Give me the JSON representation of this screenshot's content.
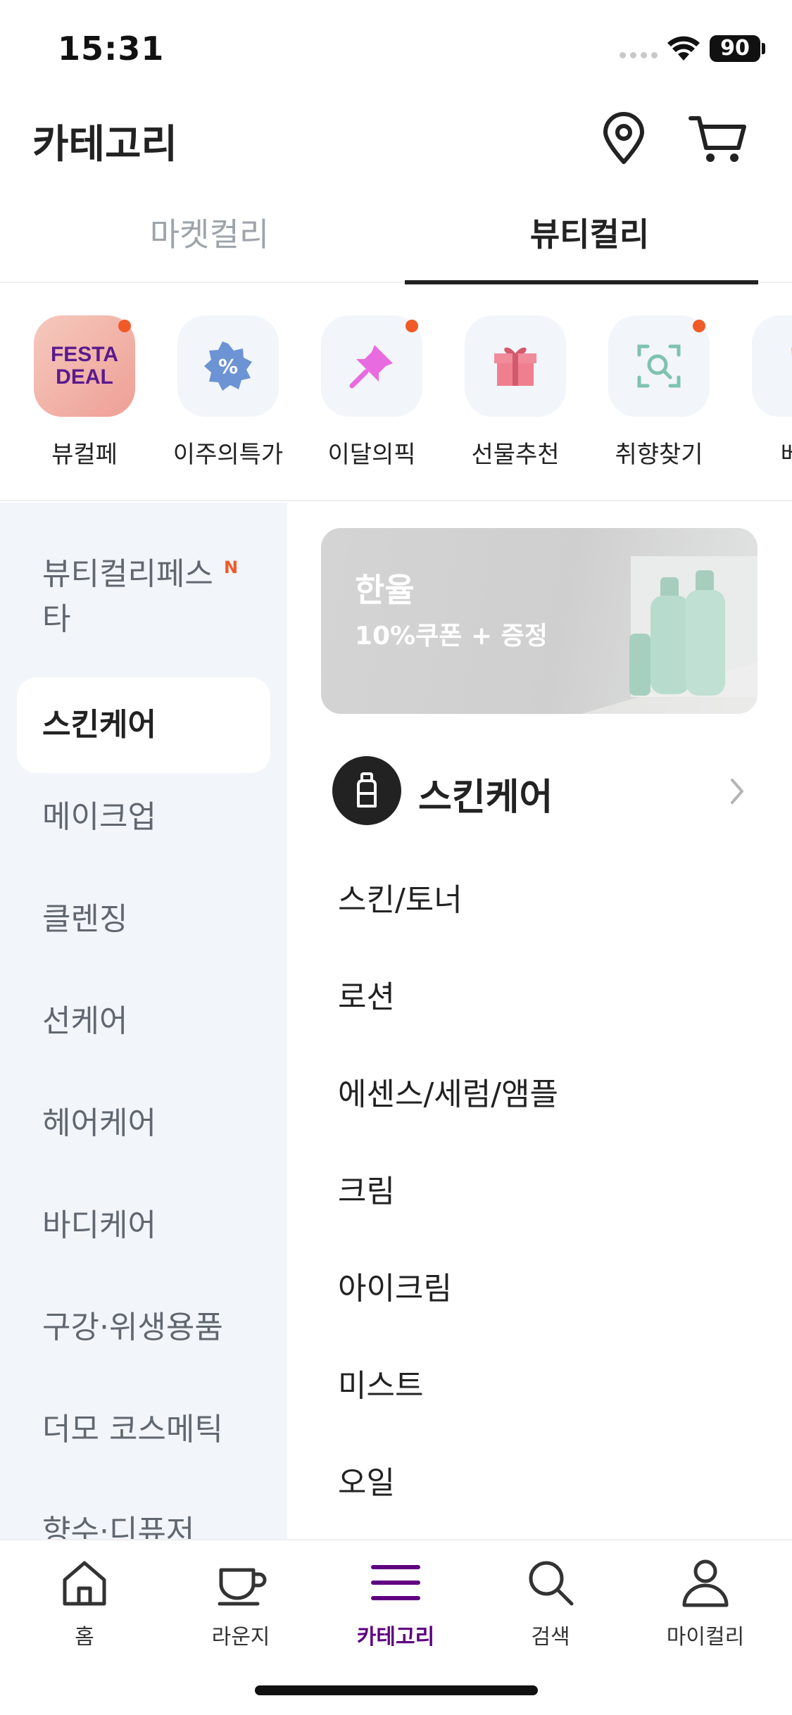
{
  "status_bar": {
    "time": "15:31",
    "battery": "90"
  },
  "header": {
    "title": "카테고리",
    "location_icon": "location-pin-icon",
    "cart_icon": "cart-icon"
  },
  "top_tabs": [
    {
      "label": "마켓컬리",
      "active": false
    },
    {
      "label": "뷰티컬리",
      "active": true
    }
  ],
  "quick_menu": [
    {
      "label": "뷰컬페",
      "icon": "festa-deal-icon",
      "icon_text_1": "FESTA",
      "icon_text_2": "DEAL",
      "dot": true
    },
    {
      "label": "이주의특가",
      "icon": "percent-badge-icon",
      "dot": false
    },
    {
      "label": "이달의픽",
      "icon": "pin-icon",
      "dot": true
    },
    {
      "label": "선물추천",
      "icon": "gift-icon",
      "dot": false
    },
    {
      "label": "취향찾기",
      "icon": "search-scan-icon",
      "dot": true
    },
    {
      "label": "베스",
      "icon": "trophy-icon",
      "dot": false
    }
  ],
  "categories": [
    {
      "label": "뷰티컬리페스타",
      "badge": "N",
      "selected": false
    },
    {
      "label": "스킨케어",
      "selected": true
    },
    {
      "label": "메이크업",
      "selected": false
    },
    {
      "label": "클렌징",
      "selected": false
    },
    {
      "label": "선케어",
      "selected": false
    },
    {
      "label": "헤어케어",
      "selected": false
    },
    {
      "label": "바디케어",
      "selected": false
    },
    {
      "label": "구강·위생용품",
      "selected": false
    },
    {
      "label": "더모 코스메틱",
      "selected": false
    },
    {
      "label": "향수·디퓨저",
      "selected": false
    }
  ],
  "banner": {
    "title": "한율",
    "subtitle": "10%쿠폰 + 증정"
  },
  "section": {
    "title": "스킨케어",
    "icon": "bottle-icon"
  },
  "subcategories": [
    "스킨/토너",
    "로션",
    "에센스/세럼/앰플",
    "크림",
    "아이크림",
    "미스트",
    "오일"
  ],
  "bottom_nav": [
    {
      "label": "홈",
      "icon": "home-icon",
      "active": false
    },
    {
      "label": "라운지",
      "icon": "cup-icon",
      "active": false
    },
    {
      "label": "카테고리",
      "icon": "menu-icon",
      "active": true
    },
    {
      "label": "검색",
      "icon": "search-icon",
      "active": false
    },
    {
      "label": "마이컬리",
      "icon": "user-icon",
      "active": false
    }
  ],
  "colors": {
    "accent": "#5f0080",
    "dot": "#f05a28",
    "panel_bg": "#f2f5f9"
  }
}
